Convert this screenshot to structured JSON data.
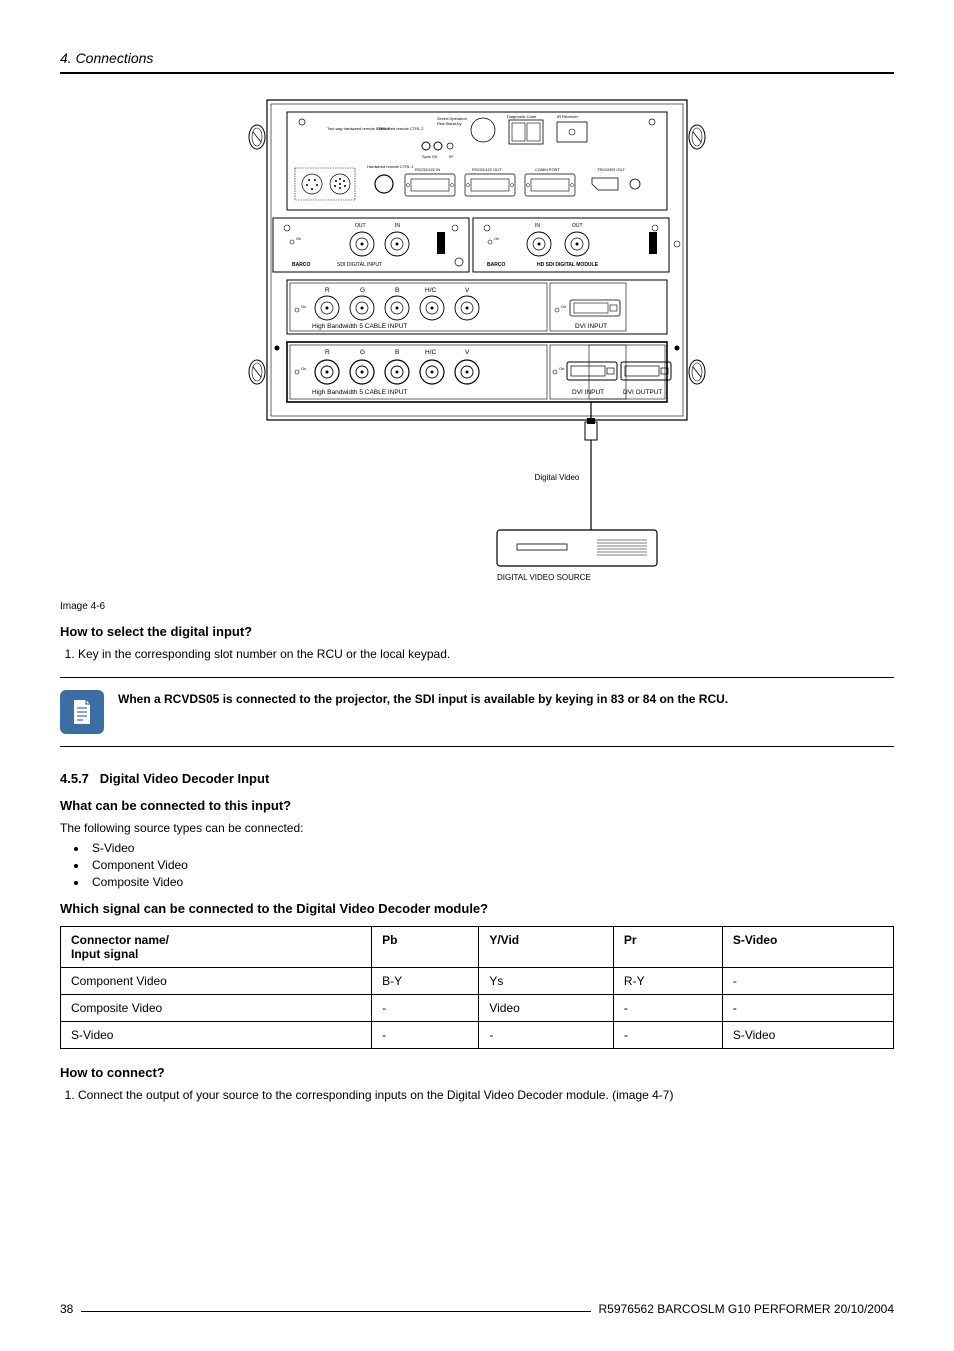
{
  "header": {
    "title": "4.  Connections"
  },
  "diagram": {
    "panel": {
      "ledGreen": "Green:Operation",
      "ledRed": "Red:Stand-by",
      "diagnosticCode": "Diagnostic Code",
      "irReceiver": "IR Receiver",
      "twoWay": "Two way hardwired remote CTRL 2",
      "hardwiredRemote2": "Hardwired remote CTRL 2",
      "hardwiredRemote1": "Hardwired remote CTRL 1",
      "syncOk": "Sync OK",
      "ir": "IR",
      "rs232in": "RS232/422 IN",
      "rs232out": "RS232/422 OUT",
      "commPort": "COMM PORT",
      "triggerOut": "TRIGGER OUT"
    },
    "row2": {
      "out": "OUT",
      "in": "IN",
      "leftLabel": "SDI DIGITAL INPUT",
      "rightLabel": "HD SDI DIGITAL MODULE",
      "barco": "BARCO",
      "on": "On"
    },
    "row3": {
      "r": "R",
      "g": "G",
      "b": "B",
      "hc": "H/C",
      "v": "V",
      "hbw": "High Bandwidth 5 CABLE INPUT",
      "dviIn": "DVI INPUT",
      "on": "On"
    },
    "row4": {
      "r": "R",
      "g": "G",
      "b": "B",
      "hc": "H/C",
      "v": "V",
      "hbw": "High Bandwidth 5 CABLE INPUT",
      "dviIn": "DVI INPUT",
      "dviOut": "DVI OUTPUT",
      "on": "On"
    },
    "cable": "Digital Video",
    "sourceBoxLabel": "DIGITAL VIDEO SOURCE"
  },
  "imageCaption": "Image 4-6",
  "selectSection": {
    "heading": "How to select the digital input?",
    "step1": "Key in the corresponding slot number on the RCU or the local keypad."
  },
  "note": {
    "text": "When a RCVDS05 is connected to the projector, the SDI input is available by keying in 83 or 84 on the RCU."
  },
  "section457": {
    "number": "4.5.7",
    "title": "Digital Video Decoder Input",
    "whatHeading": "What can be connected to this input?",
    "whatIntro": "The following source types can be connected:",
    "whatList": [
      "S-Video",
      "Component Video",
      "Composite Video"
    ],
    "whichHeading": "Which signal can be connected to the Digital Video Decoder module?",
    "table": {
      "headers": [
        "Connector name/\nInput signal",
        "Pb",
        "Y/Vid",
        "Pr",
        "S-Video"
      ],
      "rows": [
        [
          "Component Video",
          "B-Y",
          "Ys",
          "R-Y",
          "-"
        ],
        [
          "Composite Video",
          "-",
          "Video",
          "-",
          "-"
        ],
        [
          "S-Video",
          "-",
          "-",
          "-",
          "S-Video"
        ]
      ]
    },
    "howHeading": "How to connect?",
    "howStep1": "Connect the output of your source to the corresponding inputs on the Digital Video Decoder module. (image 4-7)"
  },
  "footer": {
    "pageNum": "38",
    "docRef": "R5976562  BARCOSLM G10 PERFORMER  20/10/2004"
  }
}
